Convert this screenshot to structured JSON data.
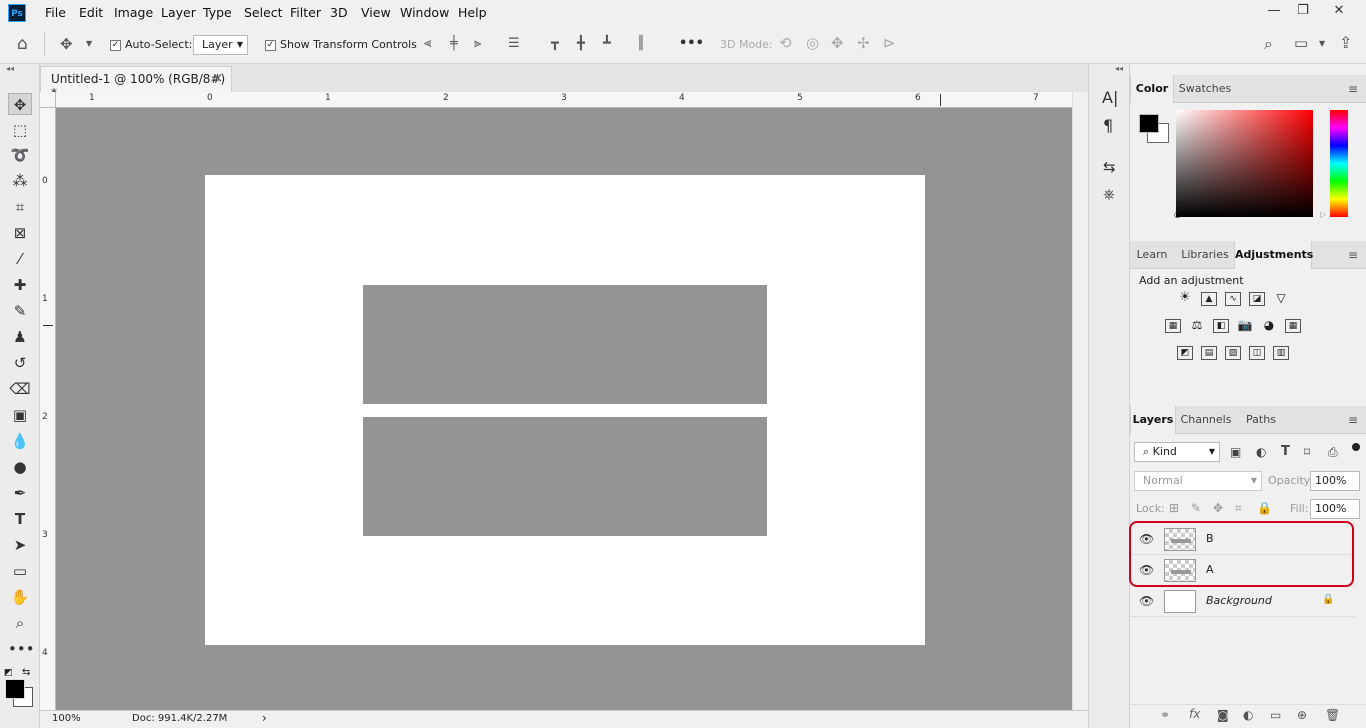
{
  "app": {
    "logo": "Ps"
  },
  "menu": [
    "File",
    "Edit",
    "Image",
    "Layer",
    "Type",
    "Select",
    "Filter",
    "3D",
    "View",
    "Window",
    "Help"
  ],
  "window_controls": {
    "minimize": "—",
    "restore": "❐",
    "close": "✕"
  },
  "options_bar": {
    "auto_select_label": "Auto-Select:",
    "auto_select_checked": true,
    "auto_select_target": "Layer",
    "transform_controls_label": "Show Transform Controls",
    "transform_controls_checked": true,
    "more_label": "•••",
    "mode_3d_label": "3D Mode:"
  },
  "document": {
    "tab_title": "Untitled-1 @ 100% (RGB/8#) *",
    "tab_close": "×",
    "zoom": "100%",
    "doc_info": "Doc: 991.4K/2.27M",
    "status_arrow": "›"
  },
  "rulers": {
    "horizontal": [
      "1",
      "0",
      "1",
      "2",
      "3",
      "4",
      "5",
      "6",
      "7"
    ],
    "vertical": [
      "0",
      "1",
      "2",
      "3",
      "4"
    ]
  },
  "color_panel": {
    "tabs": [
      "Color",
      "Swatches"
    ],
    "active_tab": "Color",
    "foreground": "#000000",
    "background": "#ffffff",
    "picker_hue": "#ff0000"
  },
  "adjustments_panel": {
    "tabs": [
      "Learn",
      "Libraries",
      "Adjustments"
    ],
    "active_tab": "Adjustments",
    "heading": "Add an adjustment"
  },
  "layers_panel": {
    "tabs": [
      "Layers",
      "Channels",
      "Paths"
    ],
    "active_tab": "Layers",
    "filter_kind": "Kind",
    "blend_mode": "Normal",
    "opacity_label": "Opacity:",
    "opacity_value": "100%",
    "lock_label": "Lock:",
    "fill_label": "Fill:",
    "fill_value": "100%",
    "layers": [
      {
        "name": "B",
        "visible": true,
        "type": "shape"
      },
      {
        "name": "A",
        "visible": true,
        "type": "shape"
      },
      {
        "name": "Background",
        "visible": true,
        "type": "background",
        "locked": true
      }
    ]
  },
  "colors": {
    "canvas_gray": "#949494",
    "highlight_red": "#d0021b",
    "panel_bg": "#f0f0f0"
  }
}
